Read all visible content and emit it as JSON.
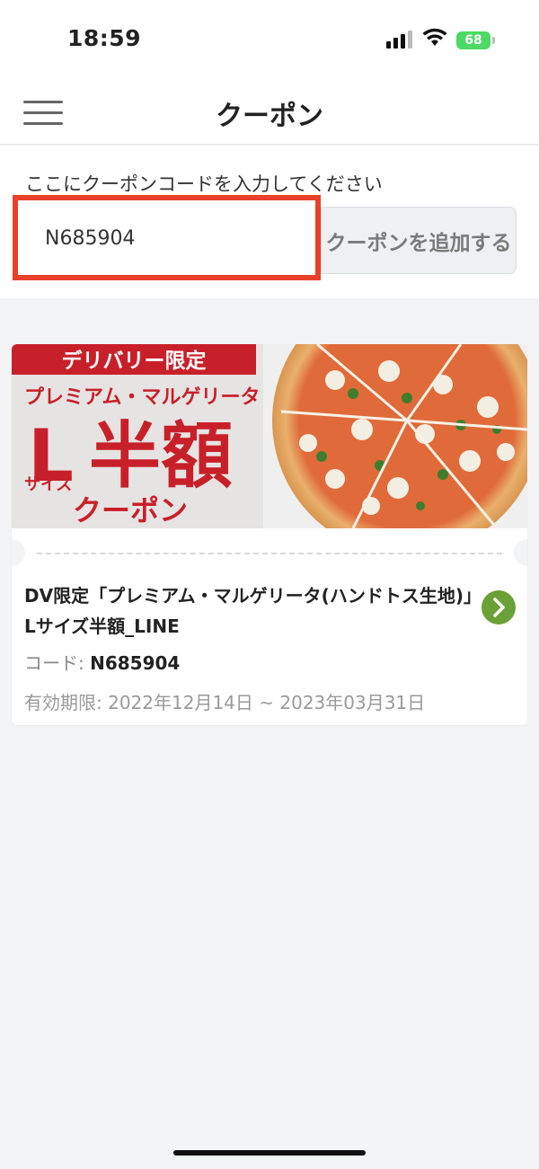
{
  "status": {
    "time": "18:59",
    "battery": "68"
  },
  "header": {
    "title": "クーポン"
  },
  "coupon_entry": {
    "label": "ここにクーポンコードを入力してください",
    "input_value": "N685904",
    "add_button": "クーポンを追加する"
  },
  "coupon": {
    "banner": {
      "ribbon": "デリバリー限定",
      "line1": "プレミアム・マルゲリータ",
      "big_l": "L",
      "big_text": "半額",
      "size": "サイズ",
      "coupon": "クーポン"
    },
    "title": "DV限定「プレミアム・マルゲリータ(ハンドトス生地)」Lサイズ半額_LINE",
    "code_label": "コード: ",
    "code_value": "N685904",
    "validity": "有効期限: 2022年12月14日 ~ 2023年03月31日"
  },
  "colors": {
    "highlight": "#e8402b",
    "banner_red": "#c8202a",
    "arrow_green": "#6aa035"
  },
  "icons": {
    "menu": "hamburger-menu-icon",
    "arrow": "chevron-right-icon"
  }
}
